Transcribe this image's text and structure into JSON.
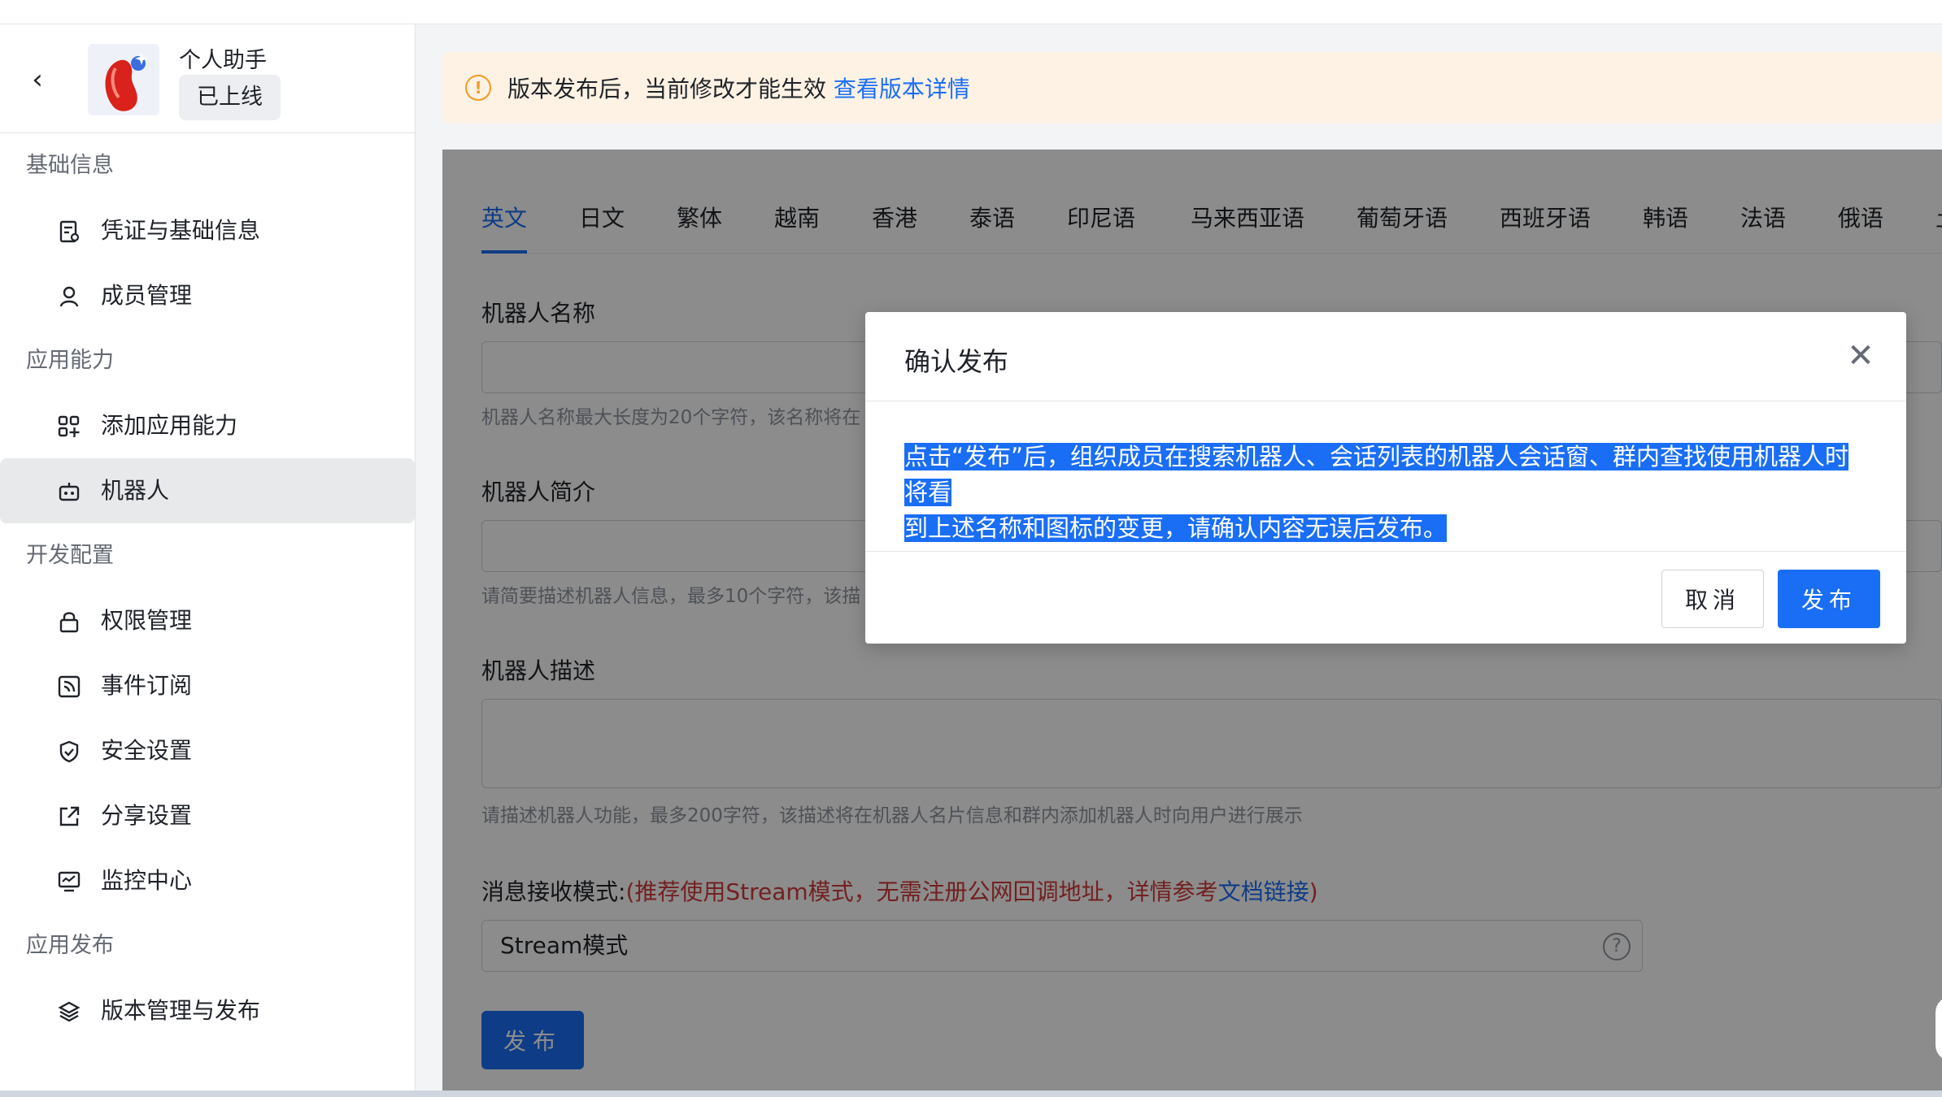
{
  "app": {
    "name": "个人助手",
    "status": "已上线"
  },
  "sidebar": {
    "sections": [
      {
        "title": "基础信息",
        "items": [
          {
            "label": "凭证与基础信息",
            "icon": "credential-icon"
          },
          {
            "label": "成员管理",
            "icon": "user-icon"
          }
        ]
      },
      {
        "title": "应用能力",
        "items": [
          {
            "label": "添加应用能力",
            "icon": "grid-add-icon"
          },
          {
            "label": "机器人",
            "icon": "robot-icon",
            "active": true
          }
        ]
      },
      {
        "title": "开发配置",
        "items": [
          {
            "label": "权限管理",
            "icon": "lock-icon"
          },
          {
            "label": "事件订阅",
            "icon": "rss-icon"
          },
          {
            "label": "安全设置",
            "icon": "shield-icon"
          },
          {
            "label": "分享设置",
            "icon": "share-icon"
          },
          {
            "label": "监控中心",
            "icon": "monitor-icon"
          }
        ]
      },
      {
        "title": "应用发布",
        "items": [
          {
            "label": "版本管理与发布",
            "icon": "layers-icon"
          }
        ]
      }
    ]
  },
  "banner": {
    "text": "版本发布后，当前修改才能生效",
    "link": "查看版本详情"
  },
  "tabs": [
    "英文",
    "日文",
    "繁体",
    "越南",
    "香港",
    "泰语",
    "印尼语",
    "马来西亚语",
    "葡萄牙语",
    "西班牙语",
    "韩语",
    "法语",
    "俄语",
    "土"
  ],
  "form": {
    "name_label": "机器人名称",
    "name_hint": "机器人名称最大长度为20个字符，该名称将在",
    "intro_label": "机器人简介",
    "intro_hint": "请简要描述机器人信息，最多10个字符，该描",
    "desc_label": "机器人描述",
    "desc_hint": "请描述机器人功能，最多200字符，该描述将在机器人名片信息和群内添加机器人时向用户进行展示",
    "mode_label": "消息接收模式:",
    "mode_note": "(推荐使用Stream模式，无需注册公网回调地址，详情参考",
    "mode_link": "文档链接",
    "mode_close": ")",
    "mode_value": "Stream模式",
    "publish_label": "发布"
  },
  "modal": {
    "title": "确认发布",
    "body_line1": "点击“发布”后，组织成员在搜索机器人、会话列表的机器人会话窗、群内查找使用机器人时将看",
    "body_line2": "到上述名称和图标的变更，请确认内容无误后发布。",
    "cancel": "取消",
    "confirm": "发布"
  },
  "colors": {
    "accent": "#1a6ef5",
    "warning": "#f59a23",
    "banner_bg": "#fdf2e3",
    "note_red": "#d13b3b"
  }
}
